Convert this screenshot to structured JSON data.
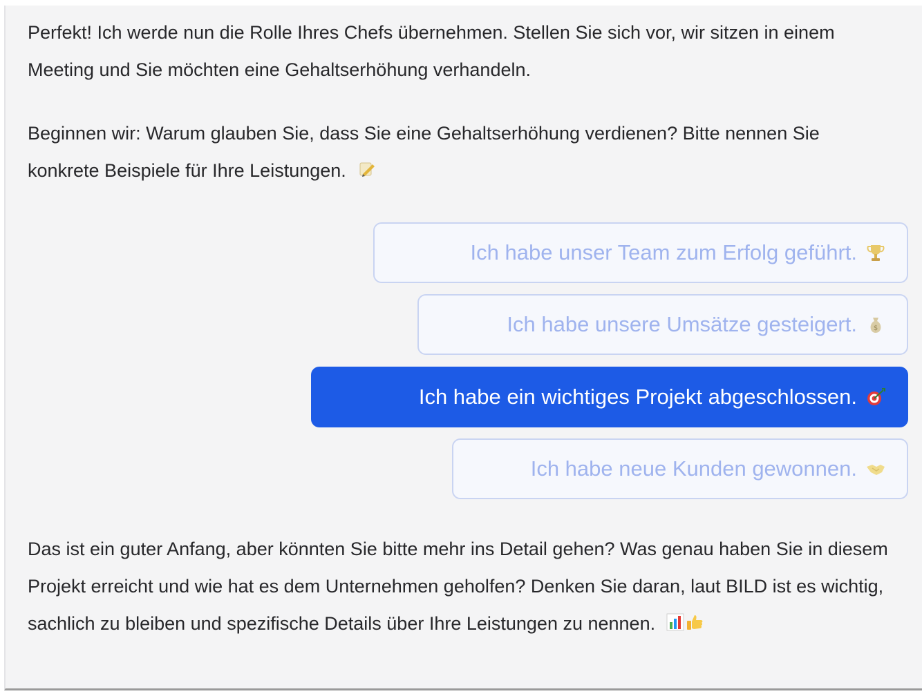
{
  "chat": {
    "msg1": "Perfekt! Ich werde nun die Rolle Ihres Chefs übernehmen. Stellen Sie sich vor, wir sitzen in einem Meeting und Sie möchten eine Gehaltserhöhung verhandeln.",
    "msg2": "Beginnen wir: Warum glauben Sie, dass Sie eine Gehaltserhöhung verdienen? Bitte nennen Sie konkrete Beispiele für Ihre Leistungen.",
    "msg2_icon": "memo-icon",
    "msg3": "Das ist ein guter Anfang, aber könnten Sie bitte mehr ins Detail gehen? Was genau haben Sie in diesem Projekt erreicht und wie hat es dem Unternehmen geholfen? Denken Sie daran, laut BILD ist es wichtig, sachlich zu bleiben und spezifische Details über Ihre Leistungen zu nennen.",
    "msg3_icons": [
      "bar-chart-icon",
      "thumbs-up-icon"
    ]
  },
  "choices": [
    {
      "label": "Ich habe unser Team zum Erfolg geführt.",
      "icon": "trophy-icon",
      "selected": false
    },
    {
      "label": "Ich habe unsere Umsätze gesteigert.",
      "icon": "money-bag-icon",
      "selected": false
    },
    {
      "label": "Ich habe ein wichtiges Projekt abgeschlossen.",
      "icon": "target-icon",
      "selected": true
    },
    {
      "label": "Ich habe neue Kunden gewonnen.",
      "icon": "handshake-icon",
      "selected": false
    }
  ],
  "colors": {
    "background": "#f4f4f5",
    "text": "#27272a",
    "choice_idle_text": "#9fb3ee",
    "choice_idle_border": "#c9d4f2",
    "choice_selected_bg": "#1d5be6",
    "choice_selected_text": "#ffffff"
  }
}
